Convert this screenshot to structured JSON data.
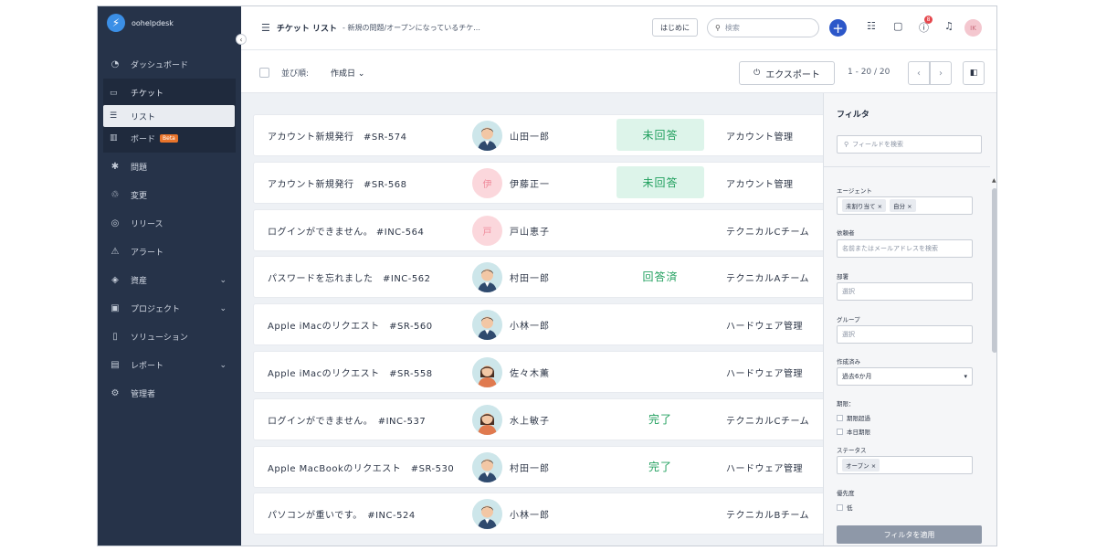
{
  "app": {
    "name": "oohelpdesk",
    "brand_color": "#263349",
    "accent": "#2c57c9"
  },
  "sidebar": {
    "items": [
      {
        "label": "ダッシュボード",
        "icon": "dashboard-icon"
      },
      {
        "label": "チケット",
        "icon": "ticket-icon"
      },
      {
        "label": "問題",
        "icon": "bug-icon"
      },
      {
        "label": "変更",
        "icon": "change-icon"
      },
      {
        "label": "リリース",
        "icon": "release-icon"
      },
      {
        "label": "アラート",
        "icon": "alert-icon"
      },
      {
        "label": "資産",
        "icon": "asset-icon"
      },
      {
        "label": "プロジェクト",
        "icon": "project-icon"
      },
      {
        "label": "ソリューション",
        "icon": "book-icon"
      },
      {
        "label": "レポート",
        "icon": "report-icon"
      },
      {
        "label": "管理者",
        "icon": "gear-icon"
      }
    ],
    "ticket_sub": {
      "list_label": "リスト",
      "board_label": "ボード",
      "beta_badge": "Beta"
    }
  },
  "header": {
    "title": "チケット リスト",
    "subtitle": "- 新規の問題/オープンになっているチケ...",
    "start_button": "はじめに",
    "search_placeholder": "検索",
    "notification_count": "8",
    "user_initials": "IK"
  },
  "toolbar": {
    "sort_label": "並び順:",
    "sort_value": "作成日 ⌄",
    "export_label": "エクスポート",
    "pager_text": "1 - 20 / 20"
  },
  "tickets": [
    {
      "title": "アカウント新規発行　#SR-574",
      "agent": "山田一郎",
      "avatar": "male",
      "status": "未回答",
      "status_pill": true,
      "group": "アカウント管理"
    },
    {
      "title": "アカウント新規発行　#SR-568",
      "agent": "伊藤正一",
      "avatar": "pink",
      "avatar_char": "伊",
      "status": "未回答",
      "status_pill": true,
      "group": "アカウント管理"
    },
    {
      "title": "ログインができません。 #INC-564",
      "agent": "戸山恵子",
      "avatar": "pink",
      "avatar_char": "戸",
      "status": "",
      "status_pill": false,
      "group": "テクニカルCチーム"
    },
    {
      "title": "パスワードを忘れました　#INC-562",
      "agent": "村田一郎",
      "avatar": "male",
      "status": "回答済",
      "status_pill": false,
      "group": "テクニカルAチーム"
    },
    {
      "title": "Apple iMacのリクエスト　#SR-560",
      "agent": "小林一郎",
      "avatar": "male",
      "status": "",
      "status_pill": false,
      "group": "ハードウェア管理"
    },
    {
      "title": "Apple iMacのリクエスト　#SR-558",
      "agent": "佐々木薫",
      "avatar": "female",
      "status": "",
      "status_pill": false,
      "group": "ハードウェア管理"
    },
    {
      "title": "ログインができません。　#INC-537",
      "agent": "水上敏子",
      "avatar": "female",
      "status": "完了",
      "status_pill": false,
      "group": "テクニカルCチーム"
    },
    {
      "title": "Apple MacBookのリクエスト　#SR-530",
      "agent": "村田一郎",
      "avatar": "male",
      "status": "完了",
      "status_pill": false,
      "group": "ハードウェア管理"
    },
    {
      "title": "パソコンが重いです。　#INC-524",
      "agent": "小林一郎",
      "avatar": "male",
      "status": "",
      "status_pill": false,
      "group": "テクニカルBチーム"
    }
  ],
  "filter": {
    "title": "フィルタ",
    "search_placeholder": "フィールドを検索",
    "agent_label": "エージェント",
    "agent_chips": [
      "未割り当て",
      "自分"
    ],
    "requester_label": "依頼者",
    "requester_placeholder": "名前またはメールアドレスを検索",
    "department_label": "部署",
    "department_placeholder": "選択",
    "group_label": "グループ",
    "group_placeholder": "選択",
    "created_label": "作成済み",
    "created_value": "過去6か月",
    "due_label": "期限：",
    "due_options": [
      "期限超過",
      "本日期限"
    ],
    "status_label": "ステータス",
    "status_chip": "オープン",
    "priority_label": "優先度",
    "priority_option": "低",
    "apply_label": "フィルタを適用"
  }
}
